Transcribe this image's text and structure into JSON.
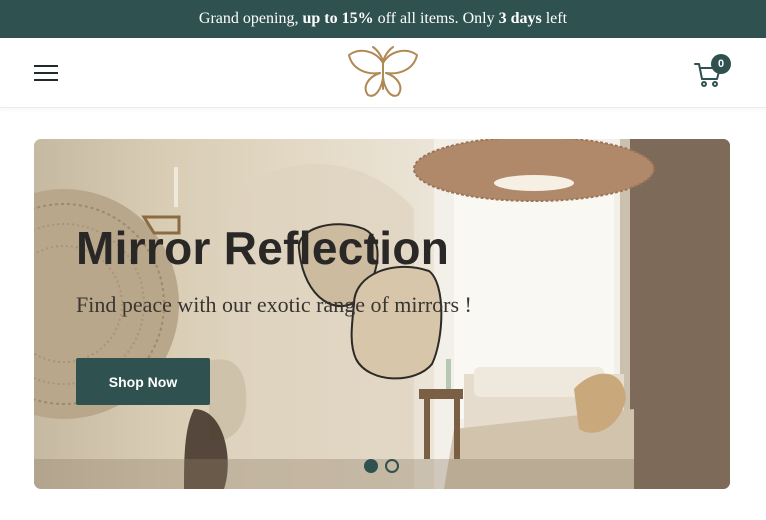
{
  "announcement": {
    "part1": "Grand opening, ",
    "part2": "up to 15%",
    "part3": " off all items. Only ",
    "part4": "3 days",
    "part5": " left"
  },
  "header": {
    "cart_count": "0",
    "menu_icon": "hamburger-menu-icon",
    "logo_icon": "butterfly-logo",
    "cart_icon": "shopping-cart-icon"
  },
  "hero": {
    "title": "Mirror Reflection",
    "subtitle": "Find peace with our exotic range of mirrors !",
    "cta_label": "Shop Now",
    "slides_total": 2,
    "active_slide": 1
  },
  "colors": {
    "brand": "#2f5150",
    "logo_gold": "#b08a55",
    "white": "#ffffff"
  }
}
